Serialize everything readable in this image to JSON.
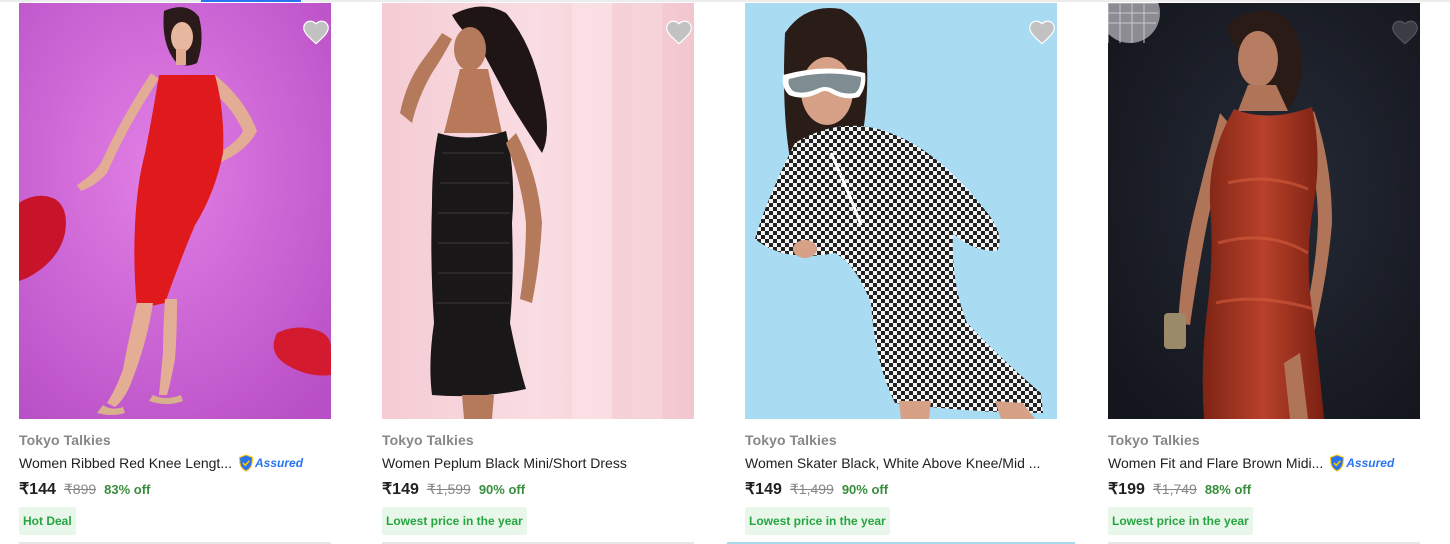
{
  "products": [
    {
      "brand": "Tokyo Talkies",
      "title": "Women Ribbed Red Knee Lengt...",
      "assured": true,
      "assured_label": "Assured",
      "price": "₹144",
      "mrp": "₹899",
      "discount": "83% off",
      "tag": "Hot Deal"
    },
    {
      "brand": "Tokyo Talkies",
      "title": "Women Peplum Black Mini/Short Dress",
      "assured": false,
      "price": "₹149",
      "mrp": "₹1,599",
      "discount": "90% off",
      "tag": "Lowest price in the year"
    },
    {
      "brand": "Tokyo Talkies",
      "title": "Women Skater Black, White Above Knee/Mid ...",
      "assured": false,
      "price": "₹149",
      "mrp": "₹1,499",
      "discount": "90% off",
      "tag": "Lowest price in the year"
    },
    {
      "brand": "Tokyo Talkies",
      "title": "Women Fit and Flare Brown Midi...",
      "assured": true,
      "assured_label": "Assured",
      "price": "₹199",
      "mrp": "₹1,749",
      "discount": "88% off",
      "tag": "Lowest price in the year"
    }
  ],
  "icons": {
    "wishlist": "heart-icon",
    "assured": "assured-shield-icon"
  },
  "colors": {
    "brand_text": "#878787",
    "discount": "#388e3c",
    "tag_bg": "#e8f7ea",
    "tag_text": "#26a541",
    "assured": "#2874f0",
    "wishlist_heart": "#c2c2c2"
  }
}
